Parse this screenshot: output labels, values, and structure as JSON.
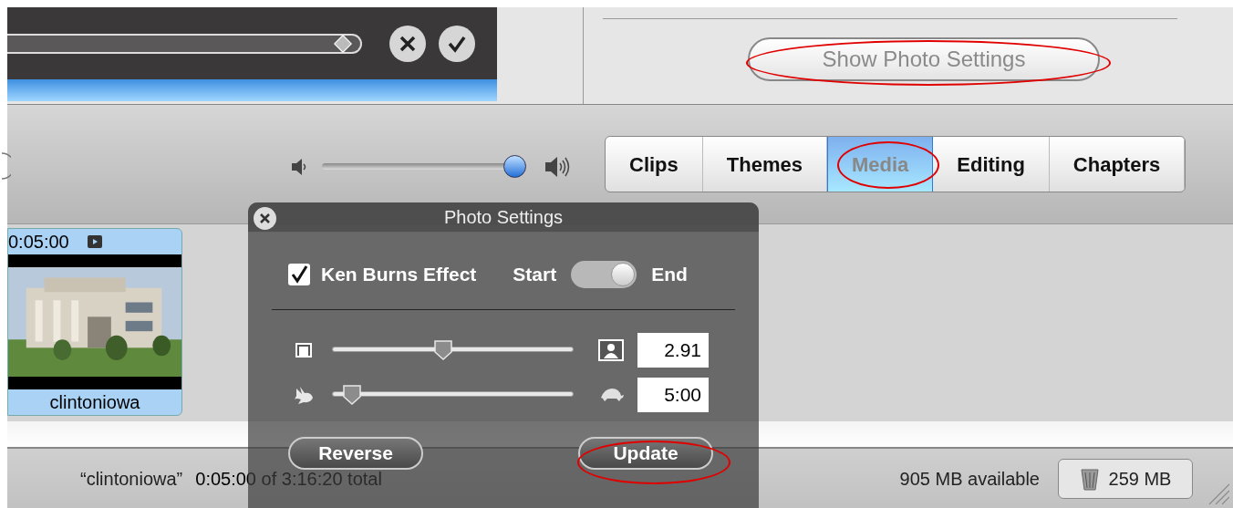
{
  "preview": {
    "scrubber": {
      "level": 0.95
    },
    "timeline_bar": {
      "level": 1
    }
  },
  "photo_settings_button": {
    "label": "Show Photo Settings",
    "disabled": true
  },
  "volume": {
    "level": 0.94
  },
  "tabs": [
    {
      "label": "Clips",
      "selected": false
    },
    {
      "label": "Themes",
      "selected": false
    },
    {
      "label": "Media",
      "selected": true
    },
    {
      "label": "Editing",
      "selected": false
    },
    {
      "label": "Chapters",
      "selected": false
    }
  ],
  "clips": [
    {
      "duration": "0:05:00",
      "name": "clintoniowa",
      "selected": true
    }
  ],
  "photo_settings": {
    "title": "Photo Settings",
    "ken_burns": {
      "label": "Ken Burns Effect",
      "checked": true
    },
    "toggle": {
      "start_label": "Start",
      "end_label": "End",
      "on": true
    },
    "sliders": [
      {
        "kind": "size",
        "level": 0.46,
        "value": "2.91"
      },
      {
        "kind": "duration",
        "level": 0.08,
        "value": "5:00"
      }
    ],
    "buttons": [
      {
        "label": "Reverse"
      },
      {
        "label": "Update"
      }
    ]
  },
  "status_bar": {
    "clip_name": "“clintoniowa”",
    "clip_info": "0:05:00 of 3:16:20 total",
    "available": "905 MB available",
    "trash": "259 MB"
  }
}
